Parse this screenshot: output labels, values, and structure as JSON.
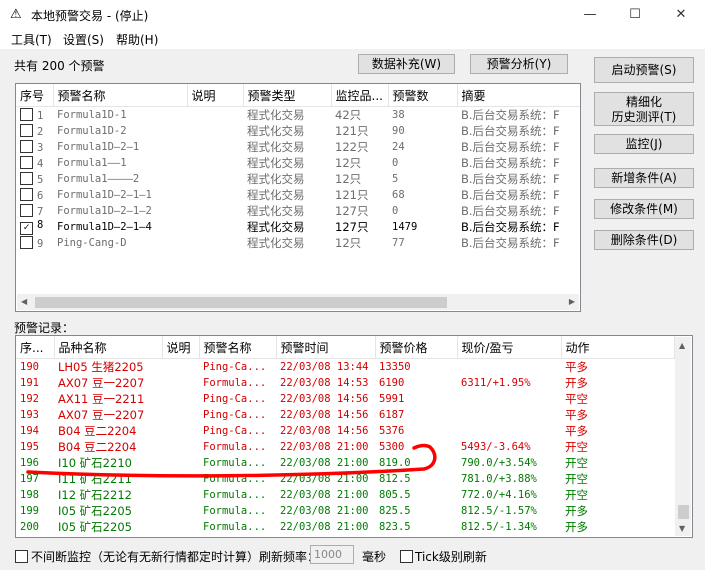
{
  "window": {
    "icon": "alert-triangle-icon",
    "title": "本地预警交易 - (停止)",
    "controls": [
      "—",
      "☐",
      "✕"
    ]
  },
  "menu": [
    "工具(T)",
    "设置(S)",
    "帮助(H)"
  ],
  "summary": {
    "count_text": "共有 200 个预警"
  },
  "top_buttons": {
    "data_supplement": "数据补充(W)",
    "alert_analysis": "预警分析(Y)"
  },
  "side_buttons": {
    "start_alert": "启动预警(S)",
    "refined_backtest_line1": "精细化",
    "refined_backtest_line2": "历史测评(T)",
    "monitor": "监控(J)",
    "add_condition": "新增条件(A)",
    "modify_condition": "修改条件(M)",
    "delete_condition": "删除条件(D)"
  },
  "conditions": {
    "columns": [
      "序号",
      "预警名称",
      "说明",
      "预警类型",
      "监控品...",
      "预警数",
      "摘要"
    ],
    "rows": [
      {
        "checked": false,
        "no": "1",
        "name": "Formula1D-1",
        "desc": "",
        "type": "程式化交易",
        "monitor": "42只",
        "count": "38",
        "summary": "B.后台交易系统：F"
      },
      {
        "checked": false,
        "no": "2",
        "name": "Formula1D-2",
        "desc": "",
        "type": "程式化交易",
        "monitor": "121只",
        "count": "90",
        "summary": "B.后台交易系统：F"
      },
      {
        "checked": false,
        "no": "3",
        "name": "Formula1D—2—1",
        "desc": "",
        "type": "程式化交易",
        "monitor": "122只",
        "count": "24",
        "summary": "B.后台交易系统：F"
      },
      {
        "checked": false,
        "no": "4",
        "name": "Formula1——1",
        "desc": "",
        "type": "程式化交易",
        "monitor": "12只",
        "count": "0",
        "summary": "B.后台交易系统：F"
      },
      {
        "checked": false,
        "no": "5",
        "name": "Formula1————2",
        "desc": "",
        "type": "程式化交易",
        "monitor": "12只",
        "count": "5",
        "summary": "B.后台交易系统：F"
      },
      {
        "checked": false,
        "no": "6",
        "name": "Formula1D—2—1—1",
        "desc": "",
        "type": "程式化交易",
        "monitor": "121只",
        "count": "68",
        "summary": "B.后台交易系统：F"
      },
      {
        "checked": false,
        "no": "7",
        "name": "Formula1D—2—1—2",
        "desc": "",
        "type": "程式化交易",
        "monitor": "127只",
        "count": "0",
        "summary": "B.后台交易系统：F"
      },
      {
        "checked": true,
        "no": "8",
        "name": "Formula1D—2—1—4",
        "desc": "",
        "type": "程式化交易",
        "monitor": "127只",
        "count": "1479",
        "summary": "B.后台交易系统：F"
      },
      {
        "checked": false,
        "no": "9",
        "name": "Ping-Cang-D",
        "desc": "",
        "type": "程式化交易",
        "monitor": "12只",
        "count": "77",
        "summary": "B.后台交易系统：F"
      }
    ]
  },
  "records": {
    "label": "预警记录：",
    "columns": [
      "序...",
      "品种名称",
      "说明",
      "预警名称",
      "预警时间",
      "预警价格",
      "现价/盈亏",
      "动作"
    ],
    "rows": [
      {
        "color": "red",
        "no": "190",
        "name": "LH05 生猪2205",
        "desc": "",
        "alert": "Ping-Ca...",
        "time": "22/03/08 13:44",
        "price": "13350",
        "current": "",
        "action": "平多"
      },
      {
        "color": "red",
        "no": "191",
        "name": "AX07 豆一2207",
        "desc": "",
        "alert": "Formula...",
        "time": "22/03/08 14:53",
        "price": "6190",
        "current": "6311/+1.95%",
        "action": "开多"
      },
      {
        "color": "red",
        "no": "192",
        "name": "AX11 豆一2211",
        "desc": "",
        "alert": "Ping-Ca...",
        "time": "22/03/08 14:56",
        "price": "5991",
        "current": "",
        "action": "平空"
      },
      {
        "color": "red",
        "no": "193",
        "name": "AX07 豆一2207",
        "desc": "",
        "alert": "Ping-Ca...",
        "time": "22/03/08 14:56",
        "price": "6187",
        "current": "",
        "action": "平多"
      },
      {
        "color": "red",
        "no": "194",
        "name": "B04 豆二2204",
        "desc": "",
        "alert": "Ping-Ca...",
        "time": "22/03/08 14:56",
        "price": "5376",
        "current": "",
        "action": "平多"
      },
      {
        "color": "red",
        "no": "195",
        "name": "B04 豆二2204",
        "desc": "",
        "alert": "Formula...",
        "time": "22/03/08 21:00",
        "price": "5300",
        "current": "5493/-3.64%",
        "action": "开空"
      },
      {
        "color": "green",
        "no": "196",
        "name": "I10 矿石2210",
        "desc": "",
        "alert": "Formula...",
        "time": "22/03/08 21:00",
        "price": "819.0",
        "current": "790.0/+3.54%",
        "action": "开空"
      },
      {
        "color": "green",
        "no": "197",
        "name": "I11 矿石2211",
        "desc": "",
        "alert": "Formula...",
        "time": "22/03/08 21:00",
        "price": "812.5",
        "current": "781.0/+3.88%",
        "action": "开空"
      },
      {
        "color": "green",
        "no": "198",
        "name": "I12 矿石2212",
        "desc": "",
        "alert": "Formula...",
        "time": "22/03/08 21:00",
        "price": "805.5",
        "current": "772.0/+4.16%",
        "action": "开空"
      },
      {
        "color": "green",
        "no": "199",
        "name": "I05 矿石2205",
        "desc": "",
        "alert": "Formula...",
        "time": "22/03/08 21:00",
        "price": "825.5",
        "current": "812.5/-1.57%",
        "action": "开多"
      },
      {
        "color": "green",
        "no": "200",
        "name": "I05 矿石2205",
        "desc": "",
        "alert": "Formula...",
        "time": "22/03/08 21:00",
        "price": "823.5",
        "current": "812.5/-1.34%",
        "action": "开多"
      }
    ]
  },
  "bottom": {
    "continuous_monitor_label": "不间断监控（无论有无新行情都定时计算）刷新频率：",
    "refresh_rate": "1000",
    "unit": "毫秒",
    "tick_refresh_label": "Tick级别刷新"
  },
  "colors": {
    "loss_red": "#d40000",
    "gain_green": "#007a00",
    "annotation_red": "#ff0000"
  }
}
